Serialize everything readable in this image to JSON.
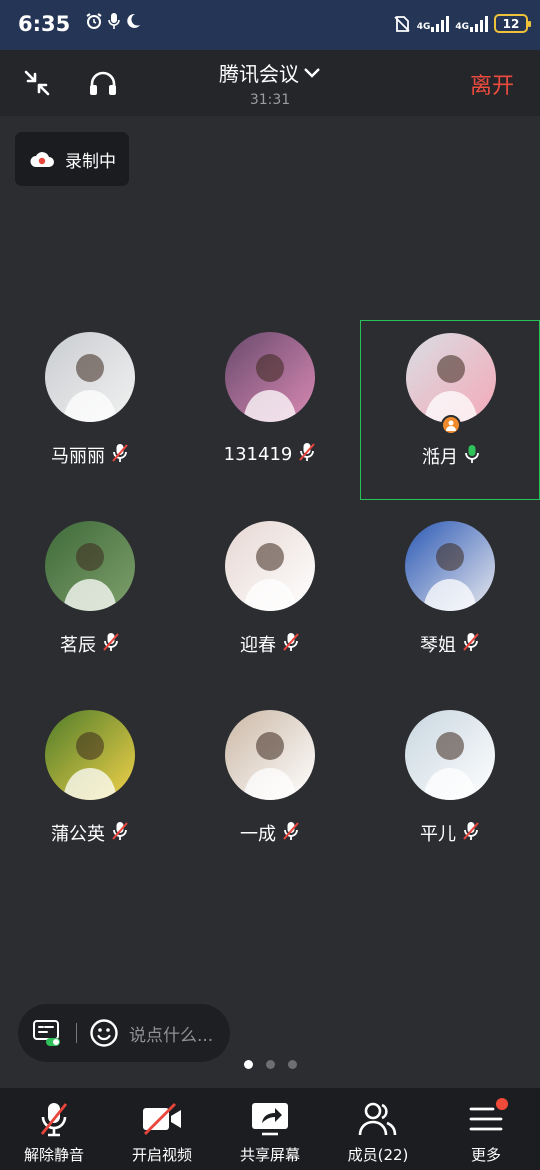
{
  "status_bar": {
    "time": "6:35",
    "net1": "4G",
    "net2": "4G",
    "battery": "12"
  },
  "header": {
    "title": "腾讯会议",
    "timer": "31:31",
    "leave_label": "离开"
  },
  "recording": {
    "label": "录制中"
  },
  "participants": [
    {
      "name": "马丽丽",
      "mic": "muted",
      "active": false,
      "host": false
    },
    {
      "name": "131419",
      "mic": "muted",
      "active": false,
      "host": false
    },
    {
      "name": "湉月",
      "mic": "on",
      "active": true,
      "host": true
    },
    {
      "name": "茗辰",
      "mic": "muted",
      "active": false,
      "host": false
    },
    {
      "name": "迎春",
      "mic": "muted",
      "active": false,
      "host": false
    },
    {
      "name": "琴姐",
      "mic": "muted",
      "active": false,
      "host": false
    },
    {
      "name": "蒲公英",
      "mic": "muted",
      "active": false,
      "host": false
    },
    {
      "name": "一成",
      "mic": "muted",
      "active": false,
      "host": false
    },
    {
      "name": "平儿",
      "mic": "muted",
      "active": false,
      "host": false
    }
  ],
  "chat": {
    "placeholder": "说点什么..."
  },
  "pager": {
    "pages": 3,
    "current": 1
  },
  "toolbar": {
    "unmute": "解除静音",
    "video": "开启视频",
    "share": "共享屏幕",
    "members": "成员(22)",
    "more": "更多"
  },
  "colors": {
    "leave": "#ee4b3f",
    "active_border": "#27c05a",
    "muted_slash": "#e8453c",
    "mic_on": "#2fc25b"
  }
}
